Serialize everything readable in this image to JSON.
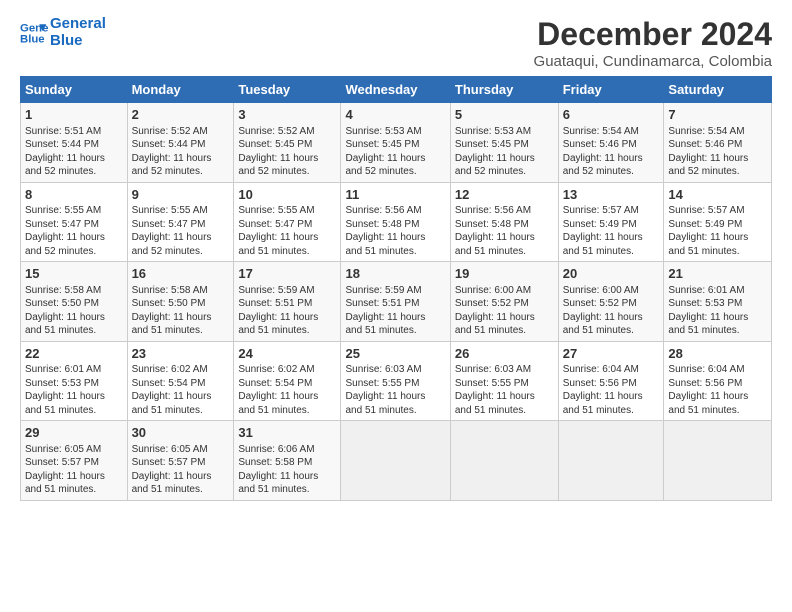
{
  "header": {
    "logo_line1": "General",
    "logo_line2": "Blue",
    "month": "December 2024",
    "location": "Guataqui, Cundinamarca, Colombia"
  },
  "weekdays": [
    "Sunday",
    "Monday",
    "Tuesday",
    "Wednesday",
    "Thursday",
    "Friday",
    "Saturday"
  ],
  "weeks": [
    [
      {
        "day": "1",
        "info": "Sunrise: 5:51 AM\nSunset: 5:44 PM\nDaylight: 11 hours\nand 52 minutes."
      },
      {
        "day": "2",
        "info": "Sunrise: 5:52 AM\nSunset: 5:44 PM\nDaylight: 11 hours\nand 52 minutes."
      },
      {
        "day": "3",
        "info": "Sunrise: 5:52 AM\nSunset: 5:45 PM\nDaylight: 11 hours\nand 52 minutes."
      },
      {
        "day": "4",
        "info": "Sunrise: 5:53 AM\nSunset: 5:45 PM\nDaylight: 11 hours\nand 52 minutes."
      },
      {
        "day": "5",
        "info": "Sunrise: 5:53 AM\nSunset: 5:45 PM\nDaylight: 11 hours\nand 52 minutes."
      },
      {
        "day": "6",
        "info": "Sunrise: 5:54 AM\nSunset: 5:46 PM\nDaylight: 11 hours\nand 52 minutes."
      },
      {
        "day": "7",
        "info": "Sunrise: 5:54 AM\nSunset: 5:46 PM\nDaylight: 11 hours\nand 52 minutes."
      }
    ],
    [
      {
        "day": "8",
        "info": "Sunrise: 5:55 AM\nSunset: 5:47 PM\nDaylight: 11 hours\nand 52 minutes."
      },
      {
        "day": "9",
        "info": "Sunrise: 5:55 AM\nSunset: 5:47 PM\nDaylight: 11 hours\nand 52 minutes."
      },
      {
        "day": "10",
        "info": "Sunrise: 5:55 AM\nSunset: 5:47 PM\nDaylight: 11 hours\nand 51 minutes."
      },
      {
        "day": "11",
        "info": "Sunrise: 5:56 AM\nSunset: 5:48 PM\nDaylight: 11 hours\nand 51 minutes."
      },
      {
        "day": "12",
        "info": "Sunrise: 5:56 AM\nSunset: 5:48 PM\nDaylight: 11 hours\nand 51 minutes."
      },
      {
        "day": "13",
        "info": "Sunrise: 5:57 AM\nSunset: 5:49 PM\nDaylight: 11 hours\nand 51 minutes."
      },
      {
        "day": "14",
        "info": "Sunrise: 5:57 AM\nSunset: 5:49 PM\nDaylight: 11 hours\nand 51 minutes."
      }
    ],
    [
      {
        "day": "15",
        "info": "Sunrise: 5:58 AM\nSunset: 5:50 PM\nDaylight: 11 hours\nand 51 minutes."
      },
      {
        "day": "16",
        "info": "Sunrise: 5:58 AM\nSunset: 5:50 PM\nDaylight: 11 hours\nand 51 minutes."
      },
      {
        "day": "17",
        "info": "Sunrise: 5:59 AM\nSunset: 5:51 PM\nDaylight: 11 hours\nand 51 minutes."
      },
      {
        "day": "18",
        "info": "Sunrise: 5:59 AM\nSunset: 5:51 PM\nDaylight: 11 hours\nand 51 minutes."
      },
      {
        "day": "19",
        "info": "Sunrise: 6:00 AM\nSunset: 5:52 PM\nDaylight: 11 hours\nand 51 minutes."
      },
      {
        "day": "20",
        "info": "Sunrise: 6:00 AM\nSunset: 5:52 PM\nDaylight: 11 hours\nand 51 minutes."
      },
      {
        "day": "21",
        "info": "Sunrise: 6:01 AM\nSunset: 5:53 PM\nDaylight: 11 hours\nand 51 minutes."
      }
    ],
    [
      {
        "day": "22",
        "info": "Sunrise: 6:01 AM\nSunset: 5:53 PM\nDaylight: 11 hours\nand 51 minutes."
      },
      {
        "day": "23",
        "info": "Sunrise: 6:02 AM\nSunset: 5:54 PM\nDaylight: 11 hours\nand 51 minutes."
      },
      {
        "day": "24",
        "info": "Sunrise: 6:02 AM\nSunset: 5:54 PM\nDaylight: 11 hours\nand 51 minutes."
      },
      {
        "day": "25",
        "info": "Sunrise: 6:03 AM\nSunset: 5:55 PM\nDaylight: 11 hours\nand 51 minutes."
      },
      {
        "day": "26",
        "info": "Sunrise: 6:03 AM\nSunset: 5:55 PM\nDaylight: 11 hours\nand 51 minutes."
      },
      {
        "day": "27",
        "info": "Sunrise: 6:04 AM\nSunset: 5:56 PM\nDaylight: 11 hours\nand 51 minutes."
      },
      {
        "day": "28",
        "info": "Sunrise: 6:04 AM\nSunset: 5:56 PM\nDaylight: 11 hours\nand 51 minutes."
      }
    ],
    [
      {
        "day": "29",
        "info": "Sunrise: 6:05 AM\nSunset: 5:57 PM\nDaylight: 11 hours\nand 51 minutes."
      },
      {
        "day": "30",
        "info": "Sunrise: 6:05 AM\nSunset: 5:57 PM\nDaylight: 11 hours\nand 51 minutes."
      },
      {
        "day": "31",
        "info": "Sunrise: 6:06 AM\nSunset: 5:58 PM\nDaylight: 11 hours\nand 51 minutes."
      },
      {
        "day": "",
        "info": ""
      },
      {
        "day": "",
        "info": ""
      },
      {
        "day": "",
        "info": ""
      },
      {
        "day": "",
        "info": ""
      }
    ]
  ]
}
